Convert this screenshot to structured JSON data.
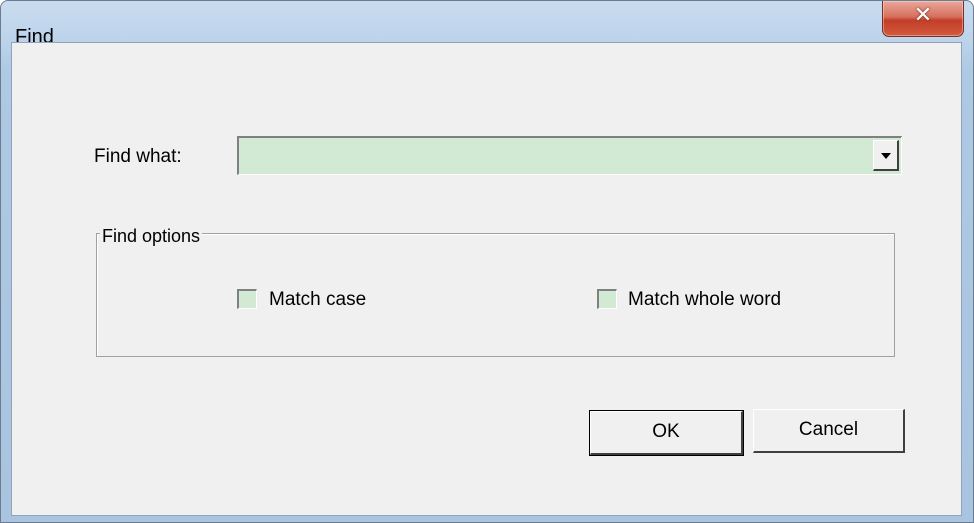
{
  "window": {
    "title": "Find",
    "close_glyph": "✕"
  },
  "find_what": {
    "label": "Find what:",
    "value": "",
    "placeholder": ""
  },
  "find_options": {
    "legend": "Find options",
    "match_case": {
      "label": "Match case",
      "checked": false
    },
    "match_whole_word": {
      "label": "Match whole word",
      "checked": false
    }
  },
  "buttons": {
    "ok_label": "OK",
    "cancel_label": "Cancel"
  },
  "colors": {
    "field_background": "#d2ead3",
    "close_button": "#c94b33",
    "dialog_background": "#f0f0f0"
  }
}
